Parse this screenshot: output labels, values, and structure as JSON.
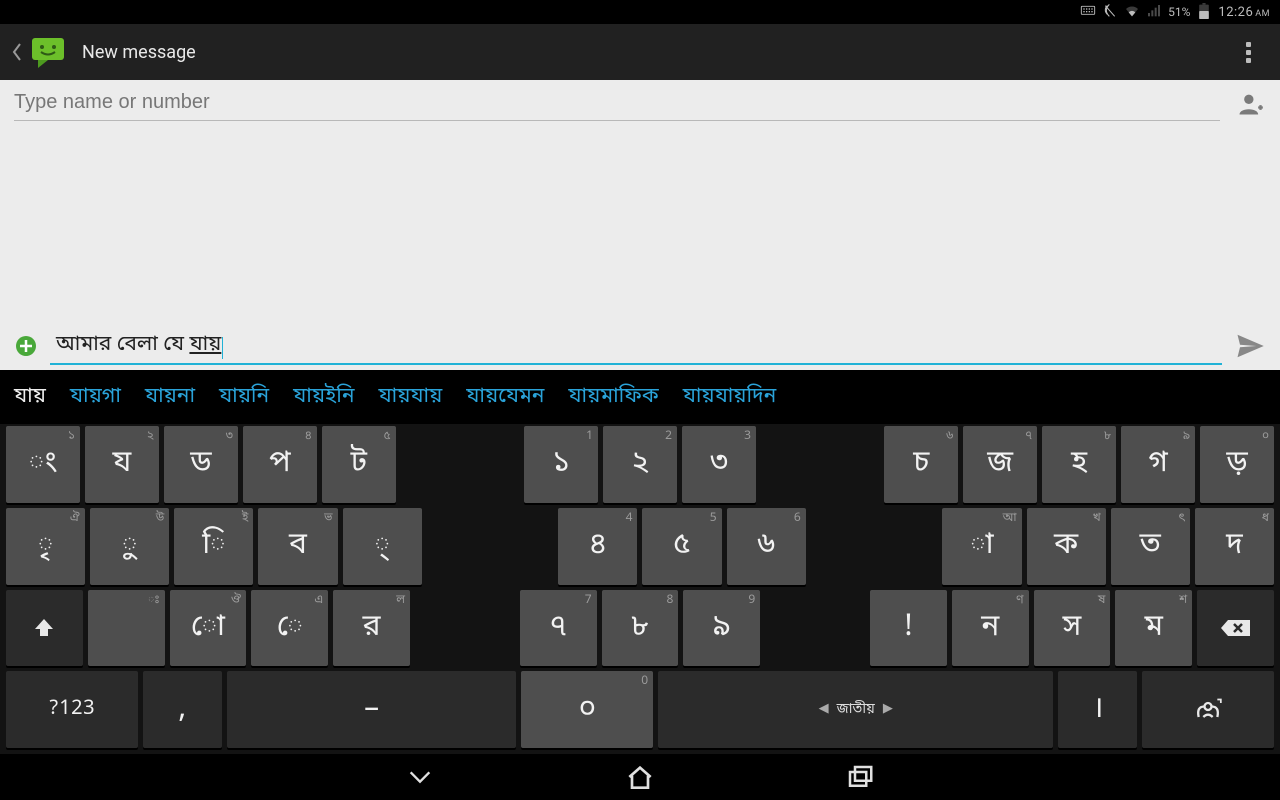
{
  "status_bar": {
    "battery_pct": "51%",
    "time": "12:26",
    "ampm": "AM"
  },
  "app_header": {
    "title": "New message"
  },
  "recipient": {
    "placeholder": "Type name or number"
  },
  "compose": {
    "text_prefix": "আমার বেলা যে ",
    "text_underlined": "যায়"
  },
  "suggestions": {
    "items": [
      "যায়",
      "যায়গা",
      "যায়না",
      "যায়নি",
      "যায়ইনি",
      "যায়যায়",
      "যায়যেমন",
      "যায়মাফিক",
      "যায়যায়দিন"
    ],
    "selected_index": 0
  },
  "keyboard": {
    "row1": [
      {
        "main": "ং",
        "sub": "১"
      },
      {
        "main": "য",
        "sub": "২"
      },
      {
        "main": "ড",
        "sub": "৩"
      },
      {
        "main": "প",
        "sub": "৪"
      },
      {
        "main": "ট",
        "sub": "৫"
      },
      {
        "gap": true
      },
      {
        "main": "১",
        "sub": "1"
      },
      {
        "main": "২",
        "sub": "2"
      },
      {
        "main": "৩",
        "sub": "3"
      },
      {
        "gap": true
      },
      {
        "main": "চ",
        "sub": "৬"
      },
      {
        "main": "জ",
        "sub": "৭"
      },
      {
        "main": "হ",
        "sub": "৮"
      },
      {
        "main": "গ",
        "sub": "৯"
      },
      {
        "main": "ড়",
        "sub": "০"
      }
    ],
    "row2": [
      {
        "main": "ৃ",
        "sub": "ঐ"
      },
      {
        "main": "ু",
        "sub": "উ"
      },
      {
        "main": "ি",
        "sub": "ই"
      },
      {
        "main": "ব",
        "sub": "ভ"
      },
      {
        "main": "্",
        "sub": ""
      },
      {
        "gap": true
      },
      {
        "main": "৪",
        "sub": "4"
      },
      {
        "main": "৫",
        "sub": "5"
      },
      {
        "main": "৬",
        "sub": "6"
      },
      {
        "gap": true
      },
      {
        "main": "া",
        "sub": "আ"
      },
      {
        "main": "ক",
        "sub": "খ"
      },
      {
        "main": "ত",
        "sub": "ৎ"
      },
      {
        "main": "দ",
        "sub": "ধ"
      }
    ],
    "row3": [
      {
        "main": "shift",
        "sub": "",
        "dark": true
      },
      {
        "main": "",
        "sub": "ঃ"
      },
      {
        "main": "ো",
        "sub": "ঔ"
      },
      {
        "main": "ে",
        "sub": "এ"
      },
      {
        "main": "র",
        "sub": "ল"
      },
      {
        "gap_sm": true
      },
      {
        "main": "৭",
        "sub": "7"
      },
      {
        "main": "৮",
        "sub": "8"
      },
      {
        "main": "৯",
        "sub": "9"
      },
      {
        "gap_sm": true
      },
      {
        "main": "!",
        "sub": ""
      },
      {
        "main": "ন",
        "sub": "ণ"
      },
      {
        "main": "স",
        "sub": "ষ"
      },
      {
        "main": "ম",
        "sub": "শ"
      },
      {
        "main": "backspace",
        "sub": "",
        "dark": true
      }
    ],
    "row4": [
      {
        "main": "?123",
        "dark": true,
        "symtxt": true
      },
      {
        "main": ",",
        "dark": true,
        "narrow": true
      },
      {
        "main": "–",
        "dark": true,
        "medspace": true
      },
      {
        "main": "০",
        "sub": "0"
      },
      {
        "main": "layout",
        "dark": true,
        "space": true,
        "layout_label": "জাতীয়"
      },
      {
        "main": "।",
        "dark": true,
        "narrow": true
      },
      {
        "main": "enter",
        "dark": true
      }
    ]
  },
  "icons": {
    "back": "back",
    "sms": "sms",
    "overflow": "overflow",
    "add_contact": "add_contact",
    "attach": "attach",
    "send": "send",
    "shift": "shift",
    "backspace": "backspace",
    "enter": "enter",
    "nav_back": "nav_back",
    "nav_home": "nav_home",
    "nav_recent": "nav_recent"
  }
}
